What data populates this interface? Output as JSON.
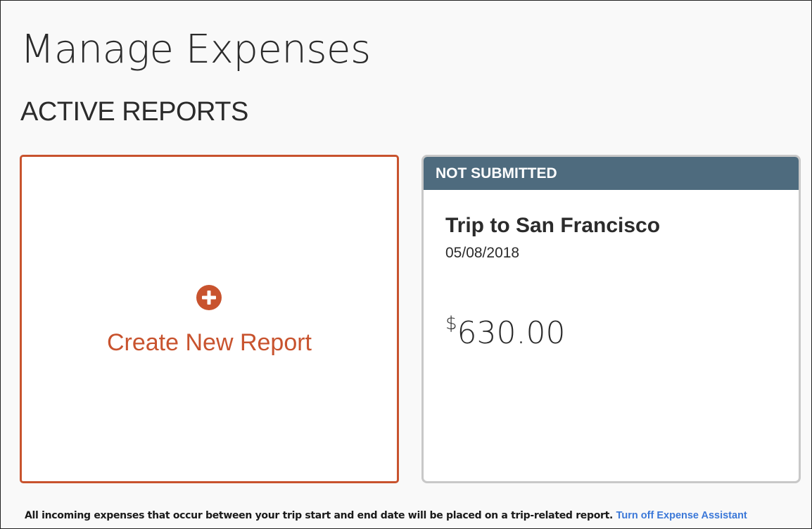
{
  "page": {
    "title": "Manage Expenses",
    "section_title": "ACTIVE REPORTS"
  },
  "create_card": {
    "icon": "plus-circle-icon",
    "label": "Create New Report",
    "accent_color": "#c8532e"
  },
  "report_card": {
    "status": "NOT SUBMITTED",
    "status_color": "#4e6b7e",
    "name": "Trip to San Francisco",
    "date": "05/08/2018",
    "currency_symbol": "$",
    "amount": "630.00"
  },
  "footer": {
    "note": "All incoming expenses that occur between your trip start and end date will be placed on a trip-related report.",
    "link_label": "Turn off Expense Assistant",
    "link_color": "#3b78d8"
  }
}
